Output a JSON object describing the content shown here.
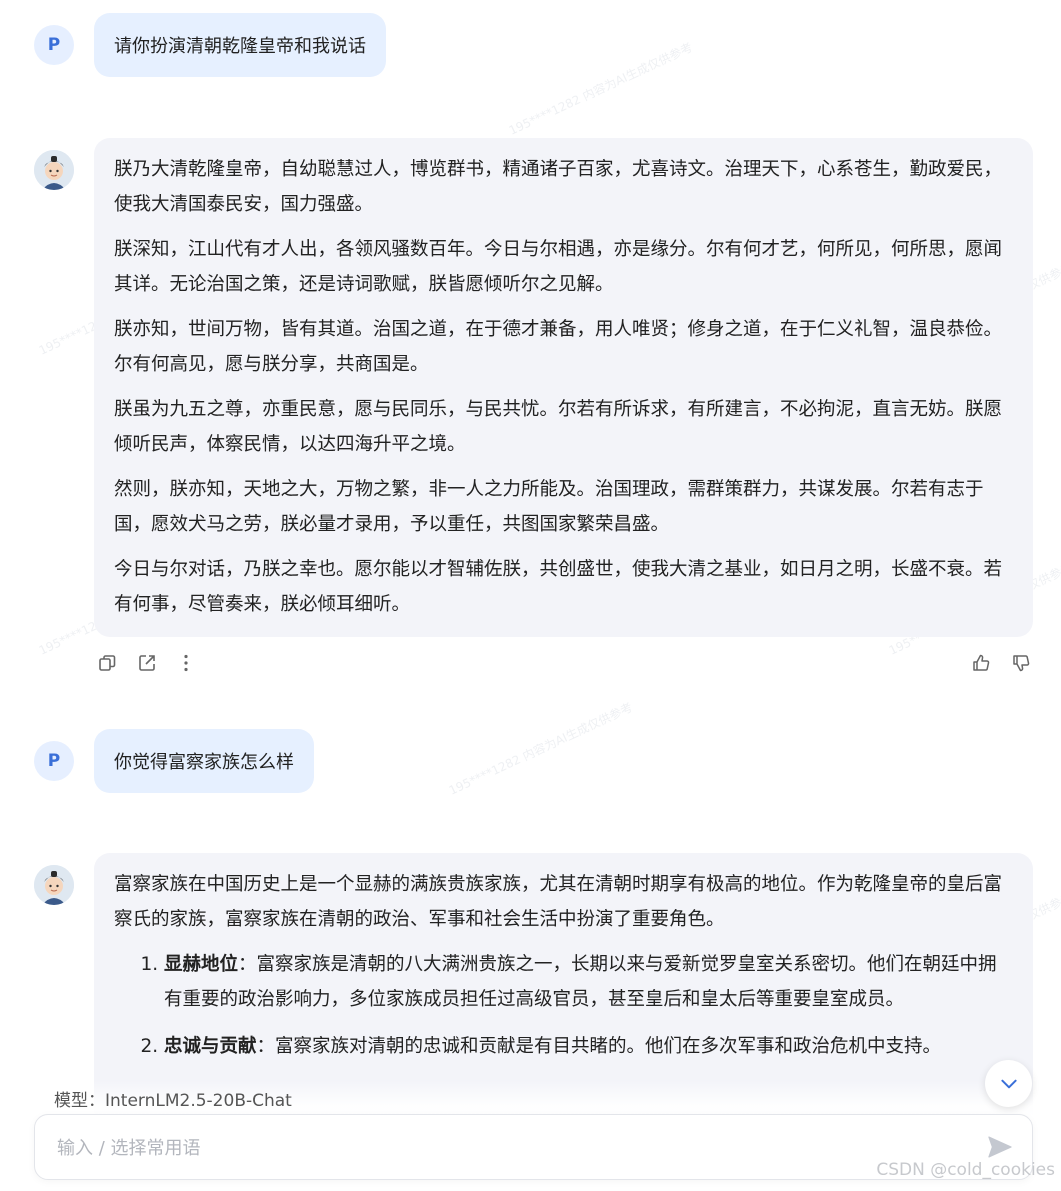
{
  "user_avatar_letter": "P",
  "messages": {
    "m1": {
      "text": "请你扮演清朝乾隆皇帝和我说话"
    },
    "m2": {
      "paragraphs": [
        "朕乃大清乾隆皇帝，自幼聪慧过人，博览群书，精通诸子百家，尤喜诗文。治理天下，心系苍生，勤政爱民，使我大清国泰民安，国力强盛。",
        "朕深知，江山代有才人出，各领风骚数百年。今日与尔相遇，亦是缘分。尔有何才艺，何所见，何所思，愿闻其详。无论治国之策，还是诗词歌赋，朕皆愿倾听尔之见解。",
        "朕亦知，世间万物，皆有其道。治国之道，在于德才兼备，用人唯贤；修身之道，在于仁义礼智，温良恭俭。尔有何高见，愿与朕分享，共商国是。",
        "朕虽为九五之尊，亦重民意，愿与民同乐，与民共忧。尔若有所诉求，有所建言，不必拘泥，直言无妨。朕愿倾听民声，体察民情，以达四海升平之境。",
        "然则，朕亦知，天地之大，万物之繁，非一人之力所能及。治国理政，需群策群力，共谋发展。尔若有志于国，愿效犬马之劳，朕必量才录用，予以重任，共图国家繁荣昌盛。",
        "今日与尔对话，乃朕之幸也。愿尔能以才智辅佐朕，共创盛世，使我大清之基业，如日月之明，长盛不衰。若有何事，尽管奏来，朕必倾耳细听。"
      ]
    },
    "m3": {
      "text": "你觉得富察家族怎么样"
    },
    "m4": {
      "intro": "富察家族在中国历史上是一个显赫的满族贵族家族，尤其在清朝时期享有极高的地位。作为乾隆皇帝的皇后富察氏的家族，富察家族在清朝的政治、军事和社会生活中扮演了重要角色。",
      "points": [
        {
          "title": "显赫地位",
          "sep": "：",
          "body": "富察家族是清朝的八大满洲贵族之一，长期以来与爱新觉罗皇室关系密切。他们在朝廷中拥有重要的政治影响力，多位家族成员担任过高级官员，甚至皇后和皇太后等重要皇室成员。"
        },
        {
          "title": "忠诚与贡献",
          "sep": "：",
          "body": "富察家族对清朝的忠诚和贡献是有目共睹的。他们在多次军事和政治危机中支持。"
        }
      ]
    }
  },
  "actions": {
    "copy": "copy-icon",
    "share": "share-icon",
    "more": "more-icon",
    "like": "thumbs-up-icon",
    "dislike": "thumbs-down-icon"
  },
  "model": {
    "label": "模型：InternLM2.5-20B-Chat"
  },
  "input": {
    "placeholder": "输入 / 选择常用语"
  },
  "watermark": {
    "csdn": "CSDN @cold_cookies",
    "faint": "195****1282 内容为AI生成仅供参考"
  }
}
